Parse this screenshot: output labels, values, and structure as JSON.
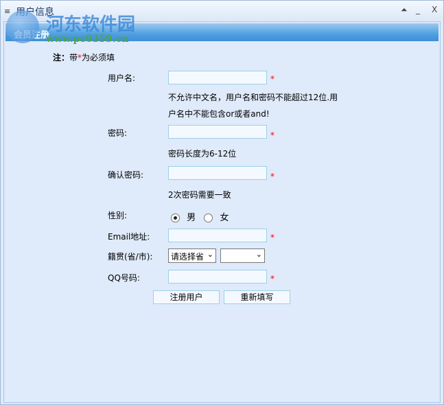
{
  "window": {
    "title": "用户信息",
    "menu_icon": "≡",
    "restore": "⏶",
    "minimize": "_",
    "close": "X"
  },
  "watermark": {
    "name": "河东软件园",
    "url": "www.pc0359.cn"
  },
  "panel": {
    "header": "会员注册",
    "note_prefix": "注：",
    "note_a": "带",
    "note_star": "*",
    "note_b": "为必须填"
  },
  "form": {
    "username": {
      "label": "用户名:",
      "value": "",
      "hint1": "不允许中文名，用户名和密码不能超过12位.用",
      "hint2": "户名中不能包含or或者and!"
    },
    "password": {
      "label": "密码:",
      "value": "",
      "hint": "密码长度为6-12位"
    },
    "confirm": {
      "label": "确认密码:",
      "value": "",
      "hint": "2次密码需要一致"
    },
    "gender": {
      "label": "性别:",
      "options": [
        "男",
        "女"
      ],
      "selected": "男"
    },
    "email": {
      "label": "Email地址:",
      "value": ""
    },
    "origin": {
      "label": "籍贯(省/市):",
      "province": "请选择省",
      "city": ""
    },
    "qq": {
      "label": "QQ号码:",
      "value": ""
    },
    "star": "*"
  },
  "buttons": {
    "submit": "注册用户",
    "reset": "重新填写"
  },
  "colors": {
    "header": "#4f9fe0",
    "required": "#ff0000",
    "background": "#dfeafa"
  }
}
